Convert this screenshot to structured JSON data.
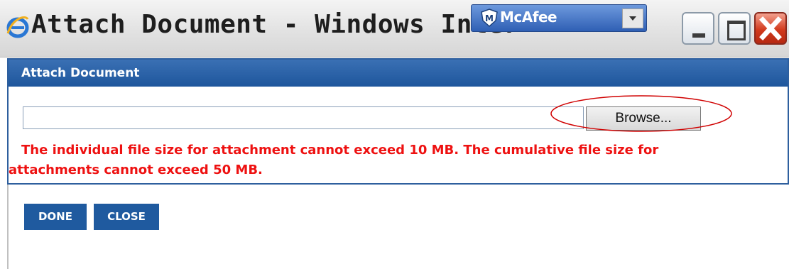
{
  "window": {
    "title": "Attach Document - Windows Inter",
    "icon": "internet-explorer-icon",
    "toolbar": {
      "brand": "McAfee",
      "dropdown_icon": "chevron-down-icon"
    },
    "controls": [
      "minimize-icon",
      "maximize-icon",
      "close-icon"
    ]
  },
  "dialog": {
    "header": "Attach Document",
    "file_input": {
      "value": "",
      "placeholder": ""
    },
    "browse_label": "Browse...",
    "warning_line1": "The individual file size for attachment cannot exceed 10 MB. The cumulative file size for",
    "warning_line2": "attachments cannot exceed 50 MB."
  },
  "actions": {
    "done_label": "DONE",
    "close_label": "CLOSE"
  },
  "colors": {
    "header_bg": "#1e569c",
    "button_bg": "#1f5a9f",
    "warning_text": "#ee1111",
    "highlight_ellipse": "#d00000"
  }
}
